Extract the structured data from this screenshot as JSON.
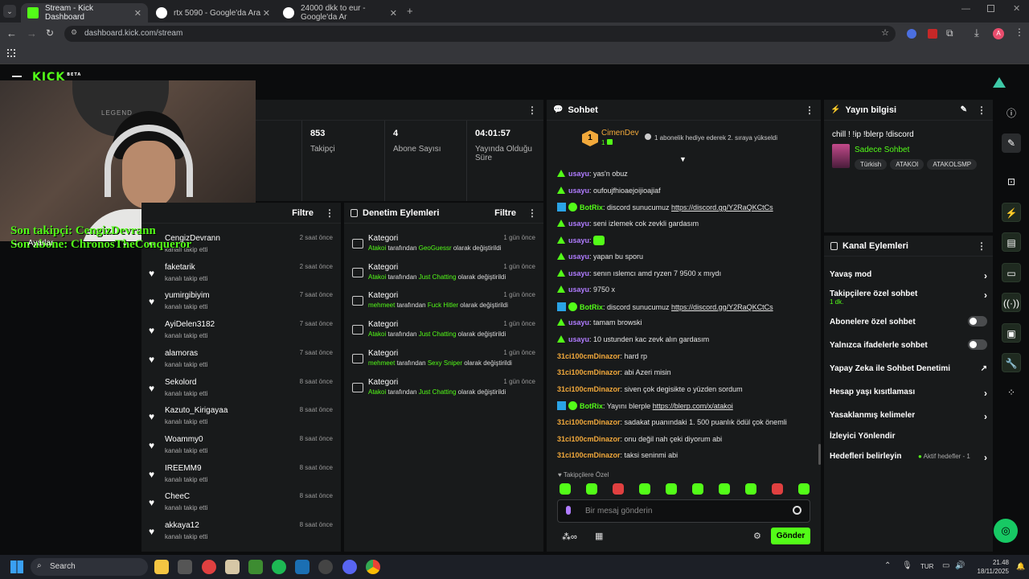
{
  "browser": {
    "tabs": [
      {
        "title": "Stream - Kick Dashboard",
        "favicon_color": "#53fc18"
      },
      {
        "title": "rtx 5090 - Google'da Ara",
        "favicon_color": "#ffffff"
      },
      {
        "title": "24000 dkk to eur - Google'da Ar",
        "favicon_color": "#ffffff"
      }
    ],
    "url": "dashboard.kick.com/stream"
  },
  "header": {
    "logo_text": "KICK",
    "beta": "BETA"
  },
  "overlay": {
    "last_follower": "Son takipçi: CengizDevrann",
    "last_sub": "Son abone: ChronosTheConqueror",
    "settings": "Ayarlar"
  },
  "stats": [
    {
      "value": "853",
      "label": "Takipçi"
    },
    {
      "value": "4",
      "label": "Abone Sayısı"
    },
    {
      "value": "04:01:57",
      "label": "Yayında Olduğu Süre"
    }
  ],
  "followers": {
    "filter_label": "Filtre",
    "items": [
      {
        "name": "CengizDevrann",
        "sub": "kanalı takip etti",
        "time": "2 saat önce"
      },
      {
        "name": "faketarik",
        "sub": "kanalı takip etti",
        "time": "2 saat önce"
      },
      {
        "name": "yumirgibiyim",
        "sub": "kanalı takip etti",
        "time": "7 saat önce"
      },
      {
        "name": "AyiDelen3182",
        "sub": "kanalı takip etti",
        "time": "7 saat önce"
      },
      {
        "name": "alamoras",
        "sub": "kanalı takip etti",
        "time": "7 saat önce"
      },
      {
        "name": "Sekolord",
        "sub": "kanalı takip etti",
        "time": "8 saat önce"
      },
      {
        "name": "Kazuto_Kirigayaa",
        "sub": "kanalı takip etti",
        "time": "8 saat önce"
      },
      {
        "name": "Woammy0",
        "sub": "kanalı takip etti",
        "time": "8 saat önce"
      },
      {
        "name": "IREEMM9",
        "sub": "kanalı takip etti",
        "time": "8 saat önce"
      },
      {
        "name": "CheeC",
        "sub": "kanalı takip etti",
        "time": "8 saat önce"
      },
      {
        "name": "akkaya12",
        "sub": "kanalı takip etti",
        "time": "8 saat önce"
      }
    ]
  },
  "moderation": {
    "title": "Denetim Eylemleri",
    "filter_label": "Filtre",
    "items": [
      {
        "title": "Kategori",
        "actor": "Atakoi",
        "mid": " tarafından ",
        "value": "GeoGuessr",
        "end": " olarak değiştirildi",
        "time": "1 gün önce"
      },
      {
        "title": "Kategori",
        "actor": "Atakoi",
        "mid": " tarafından ",
        "value": "Just Chatting",
        "end": " olarak değiştirildi",
        "time": "1 gün önce"
      },
      {
        "title": "Kategori",
        "actor": "mehmeet",
        "mid": " tarafından ",
        "value": "Fuck Hitler",
        "end": " olarak değiştirildi",
        "time": "1 gün önce"
      },
      {
        "title": "Kategori",
        "actor": "Atakoi",
        "mid": " tarafından ",
        "value": "Just Chatting",
        "end": " olarak değiştirildi",
        "time": "1 gün önce"
      },
      {
        "title": "Kategori",
        "actor": "mehmeet",
        "mid": " tarafından ",
        "value": "Sexy Sniper",
        "end": " olarak değiştirildi",
        "time": "1 gün önce"
      },
      {
        "title": "Kategori",
        "actor": "Atakoi",
        "mid": " tarafından ",
        "value": "Just Chatting",
        "end": " olarak değiştirildi",
        "time": "1 gün önce"
      }
    ]
  },
  "chat": {
    "title": "Sohbet",
    "pinned_user": "CimenDev",
    "pinned_badge": "1",
    "pinned_count": "1",
    "pinned_text": "1 abonelik hediye ederek 2. sıraya yükseldi",
    "messages": [
      {
        "user": "usayu",
        "color": "#b07cff",
        "type": "mod",
        "text": ": yas'n obuz"
      },
      {
        "user": "usayu",
        "color": "#b07cff",
        "type": "mod",
        "text": ": oufoujfhioaejoijioajiaf"
      },
      {
        "user": "BotRix",
        "color": "#53fc18",
        "type": "bot",
        "text": ": discord sunucumuz ",
        "link": "https://discord.gg/Y2RaQKCtCs"
      },
      {
        "user": "usayu",
        "color": "#b07cff",
        "type": "mod",
        "text": ": seni izlemek cok zevkli gardasım"
      },
      {
        "user": "usayu",
        "color": "#b07cff",
        "type": "mod",
        "text": ": "
      },
      {
        "user": "usayu",
        "color": "#b07cff",
        "type": "mod",
        "text": ": yapan bu sporu"
      },
      {
        "user": "usayu",
        "color": "#b07cff",
        "type": "mod",
        "text": ": senın ıslemcı amd ryzen 7 9500 x mıydı"
      },
      {
        "user": "usayu",
        "color": "#b07cff",
        "type": "mod",
        "text": ": 9750 x"
      },
      {
        "user": "BotRix",
        "color": "#53fc18",
        "type": "bot",
        "text": ": discord sunucumuz ",
        "link": "https://discord.gg/Y2RaQKCtCs"
      },
      {
        "user": "usayu",
        "color": "#b07cff",
        "type": "mod",
        "text": ": tamam browski"
      },
      {
        "user": "usayu",
        "color": "#b07cff",
        "type": "mod",
        "text": ": 10 ustunden kac zevk alın gardasım"
      },
      {
        "user": "31ci100cmDinazor",
        "color": "#f2a93b",
        "type": "plain",
        "text": ": hard rp"
      },
      {
        "user": "31ci100cmDinazor",
        "color": "#f2a93b",
        "type": "plain",
        "text": ": abi Azeri misin"
      },
      {
        "user": "31ci100cmDinazor",
        "color": "#f2a93b",
        "type": "plain",
        "text": ": siven çok degisikte o yüzden sordum"
      },
      {
        "user": "BotRix",
        "color": "#53fc18",
        "type": "bot",
        "text": ": Yayını blerple ",
        "link": "https://blerp.com/x/atakoi"
      },
      {
        "user": "31ci100cmDinazor",
        "color": "#f2a93b",
        "type": "plain",
        "text": ": sadakat puanındaki 1. 500 puanlık ödül çok önemli"
      },
      {
        "user": "31ci100cmDinazor",
        "color": "#f2a93b",
        "type": "plain",
        "text": ": onu değil nah çeki diyorum abi"
      },
      {
        "user": "31ci100cmDinazor",
        "color": "#f2a93b",
        "type": "plain",
        "text": ": taksi seninmi abi"
      }
    ],
    "followers_only": "Takipçilere Özel",
    "input_placeholder": "Bir mesaj gönderin",
    "send": "Gönder"
  },
  "stream_info": {
    "title": "Yayın bilgisi",
    "stream_title": "chill ! !ip !blerp !discord",
    "category": "Sadece Sohbet",
    "tags": [
      "Türkish",
      "ATAKOI",
      "ATAKOLSMP"
    ]
  },
  "channel_actions": {
    "title": "Kanal Eylemleri",
    "items": [
      {
        "label": "Yavaş mod",
        "control": "chevron"
      },
      {
        "label": "Takipçilere özel sohbet",
        "sub": "1 dk.",
        "control": "chevron"
      },
      {
        "label": "Abonelere özel sohbet",
        "control": "toggle"
      },
      {
        "label": "Yalnızca ifadelerle sohbet",
        "control": "toggle"
      },
      {
        "label": "Yapay Zeka ile Sohbet Denetimi",
        "control": "external"
      },
      {
        "label": "Hesap yaşı kısıtlaması",
        "control": "chevron"
      },
      {
        "label": "Yasaklanmış kelimeler",
        "control": "chevron"
      },
      {
        "label": "İzleyici Yönlendir",
        "control": "none"
      },
      {
        "label": "Hedefleri belirleyin",
        "sub": "Aktif hedefler - 1",
        "control": "chevron"
      }
    ]
  },
  "taskbar": {
    "search": "Search",
    "lang": "TUR",
    "time": "21.48",
    "date": "18/11/2025"
  }
}
